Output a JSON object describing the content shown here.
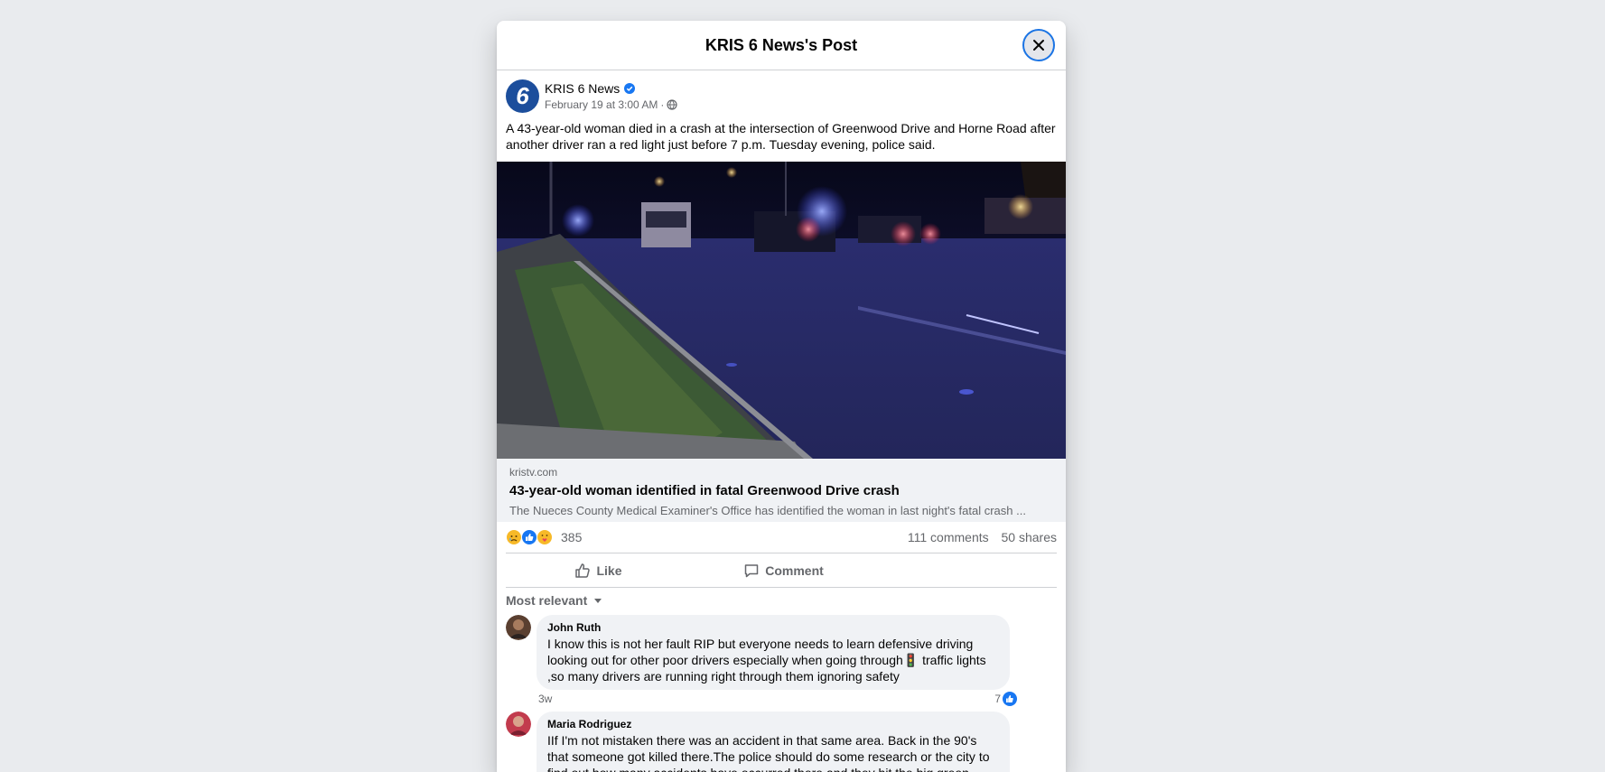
{
  "dialog": {
    "title": "KRIS 6 News's Post"
  },
  "post": {
    "author": "KRIS 6 News",
    "avatar_text": "6",
    "timestamp": "February 19 at 3:00 AM",
    "separator": "·",
    "text": "A 43-year-old woman died in a crash at the intersection of Greenwood Drive and Horne Road after another driver ran a red light just before 7 p.m. Tuesday evening, police said."
  },
  "link": {
    "domain": "kristv.com",
    "title": "43-year-old woman identified in fatal Greenwood Drive crash",
    "description": "The Nueces County Medical Examiner's Office has identified the woman in last night's fatal crash ..."
  },
  "stats": {
    "reaction_count": "385",
    "comments": "111 comments",
    "shares": "50 shares"
  },
  "actions": {
    "like": "Like",
    "comment": "Comment"
  },
  "sort_label": "Most relevant",
  "comments": [
    {
      "name": "John Ruth",
      "text": "I know this is not her fault RIP but everyone needs to learn defensive driving looking out for other poor drivers especially when going through🚦 traffic lights ,so many drivers are running right through them ignoring safety",
      "time": "3w",
      "likes": "7"
    },
    {
      "name": "Maria Rodriguez",
      "text": "IIf I'm not mistaken there was an accident in that same area. Back in the 90's that someone got killed there.The police should do some research or the city to find out how many accidents have occurred there and they hit the big green electrical box.I might be"
    }
  ],
  "colors": {
    "accent": "#1877f2",
    "page_bg": "#e9ebee"
  }
}
